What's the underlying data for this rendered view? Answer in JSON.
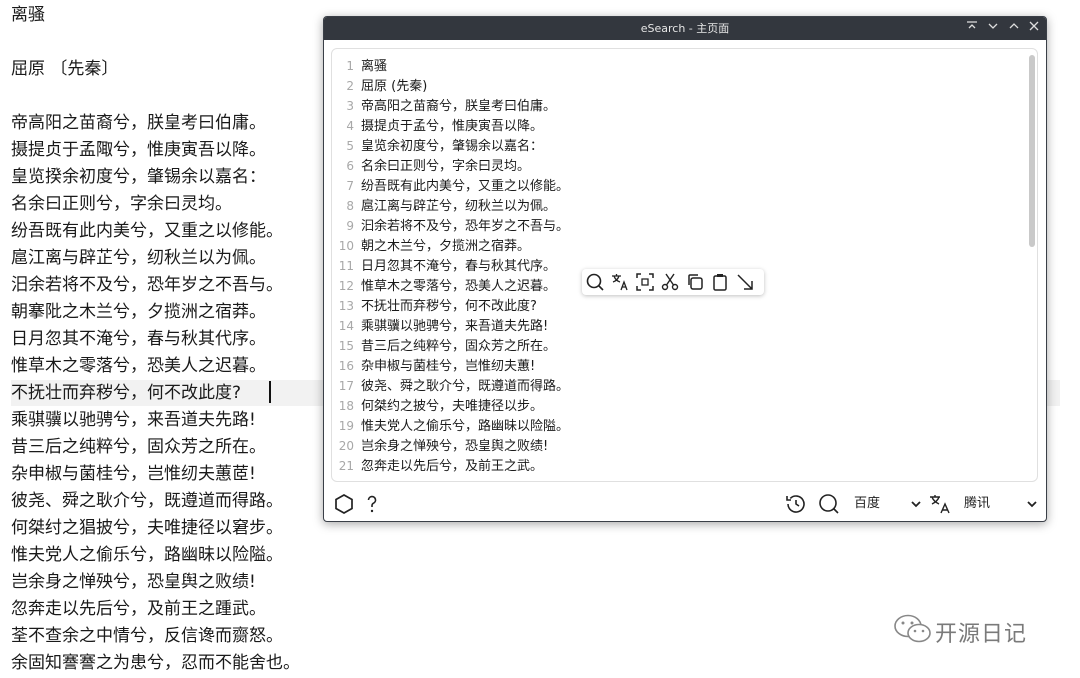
{
  "document": {
    "title": "离骚",
    "author": "屈原 〔先秦〕",
    "lines": [
      "帝高阳之苗裔兮，朕皇考曰伯庸。",
      "摄提贞于孟陬兮，惟庚寅吾以降。",
      "皇览揆余初度兮，肇锡余以嘉名：",
      "名余曰正则兮，字余曰灵均。",
      "纷吾既有此内美兮，又重之以修能。",
      "扈江离与辟芷兮，纫秋兰以为佩。",
      "汨余若将不及兮，恐年岁之不吾与。",
      "朝搴阰之木兰兮，夕揽洲之宿莽。",
      "日月忽其不淹兮，春与秋其代序。",
      "惟草木之零落兮，恐美人之迟暮。",
      "不抚壮而弃秽兮，何不改此度?",
      "乘骐骥以驰骋兮，来吾道夫先路!",
      "昔三后之纯粹兮，固众芳之所在。",
      "杂申椒与菌桂兮，岂惟纫夫蕙茝!",
      "彼尧、舜之耿介兮，既遵道而得路。",
      "何桀纣之猖披兮，夫唯捷径以窘步。",
      "惟夫党人之偷乐兮，路幽昧以险隘。",
      "岂余身之惮殃兮，恐皇舆之败绩!",
      "忽奔走以先后兮，及前王之踵武。",
      "荃不查余之中情兮，反信谗而齌怒。",
      "余固知謇謇之为患兮，忍而不能舍也。"
    ]
  },
  "window": {
    "title": "eSearch - 主页面",
    "editor_lines": [
      {
        "n": "1",
        "text": "离骚"
      },
      {
        "n": "2",
        "text": "屈原 (先秦)"
      },
      {
        "n": "3",
        "text": "帝高阳之苗裔兮，朕皇考曰伯庸。"
      },
      {
        "n": "4",
        "text": "摄提贞于孟兮，惟庚寅吾以降。"
      },
      {
        "n": "5",
        "text": "皇览余初度兮，肇锡余以嘉名："
      },
      {
        "n": "6",
        "text": "名余曰正则兮，字余曰灵均。"
      },
      {
        "n": "7",
        "text": "纷吾既有此内美兮，又重之以修能。"
      },
      {
        "n": "8",
        "text": "扈江离与辟芷兮，纫秋兰以为佩。"
      },
      {
        "n": "9",
        "text": "汩余若将不及兮，恐年岁之不吾与。"
      },
      {
        "n": "10",
        "text": "朝之木兰兮，夕揽洲之宿莽。"
      },
      {
        "n": "11",
        "text": "日月忽其不淹兮，春与秋其代序。"
      },
      {
        "n": "12",
        "text": "惟草木之零落兮，恐美人之迟暮。"
      },
      {
        "n": "13",
        "text": "不抚壮而弃秽兮，何不改此度?"
      },
      {
        "n": "14",
        "text": "乘骐骥以驰骋兮，来吾道夫先路!"
      },
      {
        "n": "15",
        "text": "昔三后之纯粹兮，固众芳之所在。"
      },
      {
        "n": "16",
        "text": "杂申椒与菌桂兮，岂惟纫夫蕙!"
      },
      {
        "n": "17",
        "text": "彼尧、舜之耿介兮，既遵道而得路。"
      },
      {
        "n": "18",
        "text": "何桀约之披兮，夫唯捷径以步。"
      },
      {
        "n": "19",
        "text": "惟夫党人之偷乐兮，路幽昧以险隘。"
      },
      {
        "n": "20",
        "text": "岂余身之惮殃兮，恐皇舆之败绩!"
      },
      {
        "n": "21",
        "text": "忽奔走以先后兮，及前王之武。"
      }
    ],
    "search_engine": "百度",
    "translate_engine": "腾讯"
  },
  "watermark": "开源日记",
  "colors": {
    "titlebar": "#33373e",
    "highlight": "#f2f2f2",
    "scrollbar": "#c9c9c9"
  }
}
